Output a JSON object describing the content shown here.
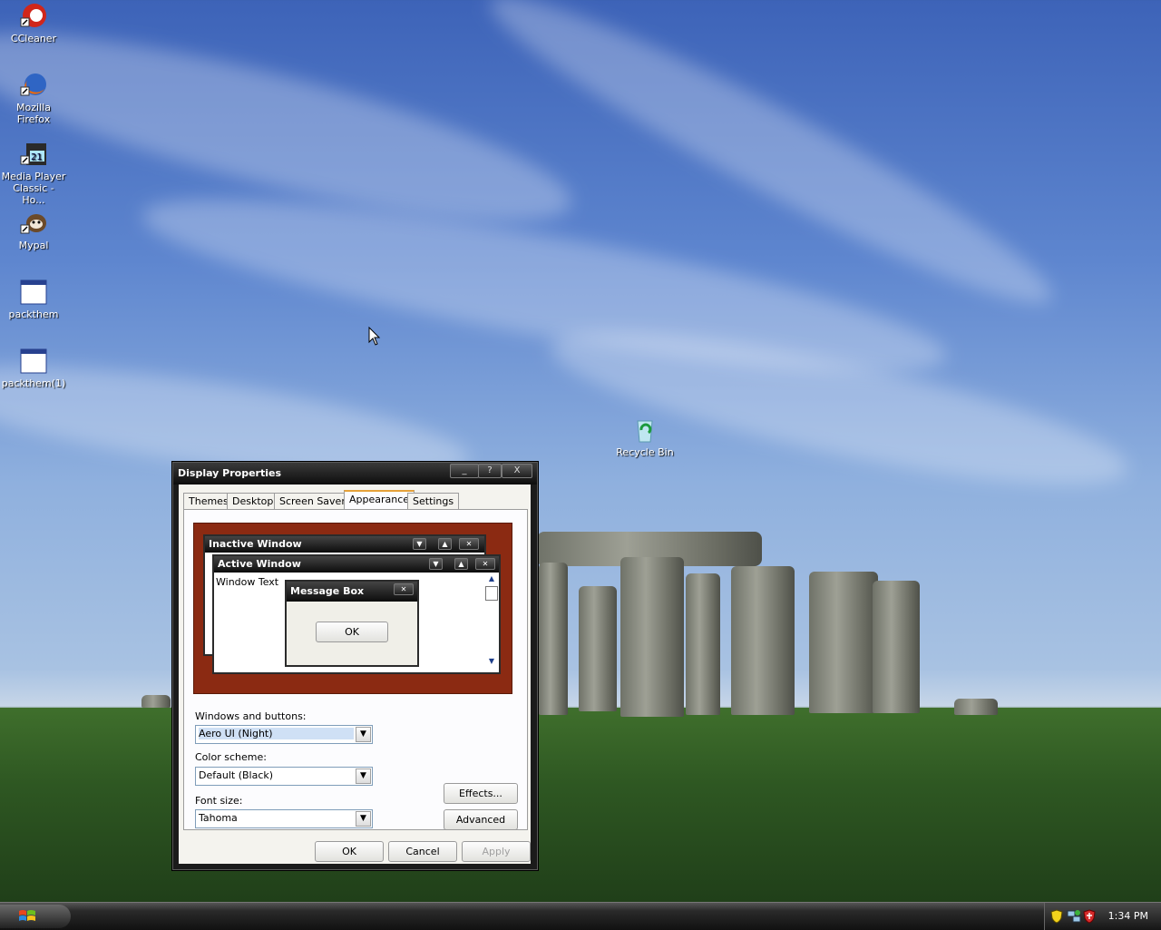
{
  "desktop": {
    "icons": [
      {
        "label": "CCleaner",
        "icon": "ccleaner-icon"
      },
      {
        "label": "Mozilla Firefox",
        "icon": "firefox-icon"
      },
      {
        "label": "Media Player Classic - Ho...",
        "icon": "media-player-icon"
      },
      {
        "label": "Mypal",
        "icon": "mypal-icon"
      },
      {
        "label": "packthem",
        "icon": "application-icon"
      },
      {
        "label": "packthem(1)",
        "icon": "application-icon"
      },
      {
        "label": "Recycle Bin",
        "icon": "recycle-bin-icon"
      }
    ]
  },
  "dialog": {
    "title": "Display Properties",
    "title_buttons": {
      "minimize": "_",
      "help": "?",
      "close": "X"
    },
    "tabs": [
      {
        "label": "Themes"
      },
      {
        "label": "Desktop"
      },
      {
        "label": "Screen Saver"
      },
      {
        "label": "Appearance",
        "active": true
      },
      {
        "label": "Settings"
      }
    ],
    "preview": {
      "inactive_title": "Inactive Window",
      "active_title": "Active Window",
      "window_text": "Window Text",
      "message_title": "Message Box",
      "message_ok": "OK"
    },
    "windows_buttons": {
      "label": "Windows and buttons:",
      "value": "Aero UI (Night)"
    },
    "color_scheme": {
      "label": "Color scheme:",
      "value": "Default (Black)"
    },
    "font_size": {
      "label": "Font size:",
      "value": "Tahoma"
    },
    "effects_label": "Effects...",
    "advanced_label": "Advanced",
    "ok_label": "OK",
    "cancel_label": "Cancel",
    "apply_label": "Apply"
  },
  "taskbar": {
    "clock": "1:34 PM",
    "start_icon": "windows-logo-icon",
    "tray_icons": [
      "security-shield-icon",
      "network-icon",
      "antivirus-icon"
    ]
  },
  "colors": {
    "title_bar": "#0d0d0d",
    "preview_background": "#8b2a12",
    "active_tab_accent": "#e6a23a"
  }
}
